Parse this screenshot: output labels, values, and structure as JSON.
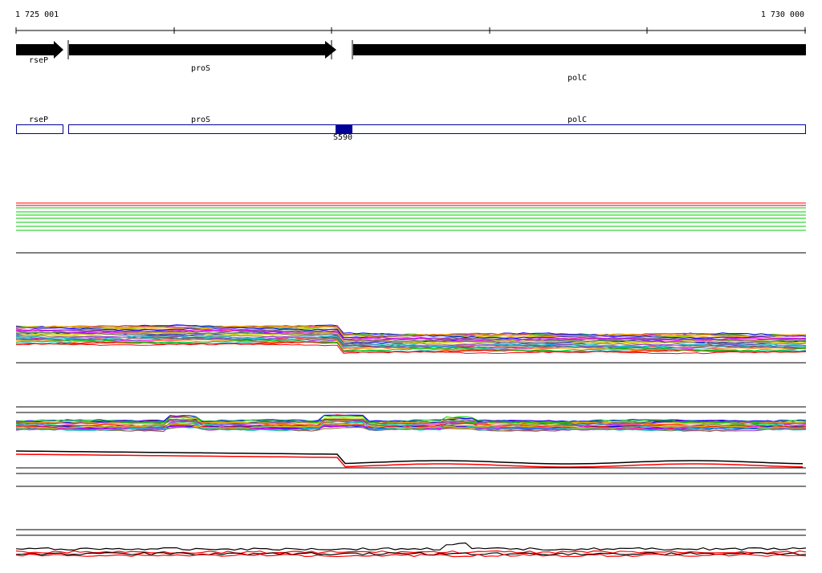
{
  "ruler": {
    "start_label": "1 725 001",
    "end_label": "1 730 000"
  },
  "genes": [
    {
      "name": "rseP"
    },
    {
      "name": "proS"
    },
    {
      "name": "polC"
    }
  ],
  "annotation_track": {
    "features": [
      {
        "name": "rseP"
      },
      {
        "name": "proS"
      },
      {
        "name": "polC"
      }
    ],
    "marker": {
      "name": "S590",
      "color": "#000099"
    }
  },
  "colors": {
    "gene_arrow": "#000000",
    "feature_outline": "#000099",
    "series_palette": [
      "#ff0000",
      "#00cc00",
      "#0000ff",
      "#ff00ff",
      "#00cccc",
      "#cccc00",
      "#996633",
      "#ff9900",
      "#666666",
      "#9933cc"
    ]
  }
}
